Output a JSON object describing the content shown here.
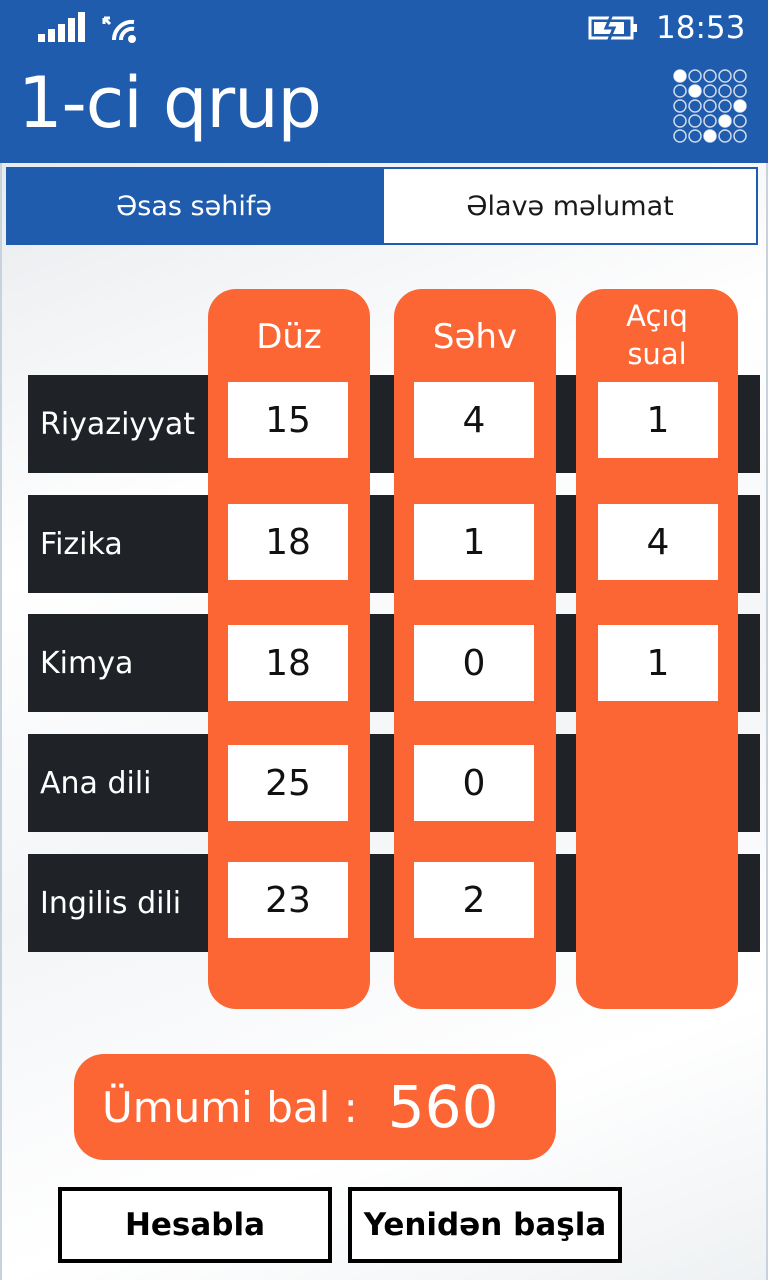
{
  "status_bar": {
    "time": "18:53"
  },
  "app": {
    "title": "1-ci qrup",
    "logo_icon": "answer-sheet-icon"
  },
  "tabs": [
    {
      "label": "Əsas səhifə",
      "selected": true
    },
    {
      "label": "Əlavə məlumat",
      "selected": false
    }
  ],
  "columns": [
    {
      "header": "Düz"
    },
    {
      "header": "Səhv"
    },
    {
      "header_line1": "Açıq",
      "header_line2": "sual"
    }
  ],
  "subjects": [
    {
      "name": "Riyaziyyat",
      "correct": "15",
      "wrong": "4",
      "open": "1"
    },
    {
      "name": "Fizika",
      "correct": "18",
      "wrong": "1",
      "open": "4"
    },
    {
      "name": "Kimya",
      "correct": "18",
      "wrong": "0",
      "open": "1"
    },
    {
      "name": "Ana dili",
      "correct": "25",
      "wrong": "0",
      "open": null
    },
    {
      "name": "Ingilis dili",
      "correct": "23",
      "wrong": "2",
      "open": null
    }
  ],
  "total": {
    "label": "Ümumi bal :",
    "value": "560"
  },
  "buttons": {
    "calculate": "Hesabla",
    "restart": "Yenidən başla"
  },
  "colors": {
    "accent_blue": "#1f5cae",
    "accent_orange": "#fc6534",
    "row_dark": "#1f2328"
  }
}
